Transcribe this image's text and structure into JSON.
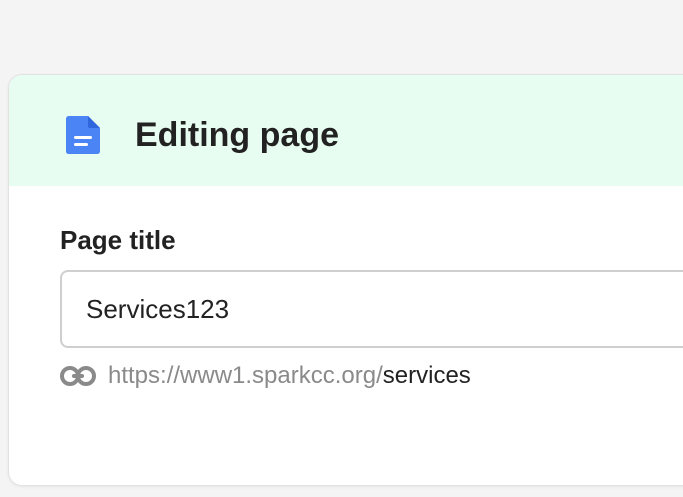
{
  "header": {
    "title": "Editing page",
    "icon": "document-icon",
    "accent_color": "#4b84f5",
    "background_color": "#e8fdf1"
  },
  "form": {
    "page_title_label": "Page title",
    "page_title_value": "Services123",
    "url_base": "https://www1.sparkcc.org/",
    "url_slug": "services",
    "url_icon": "link-icon"
  }
}
